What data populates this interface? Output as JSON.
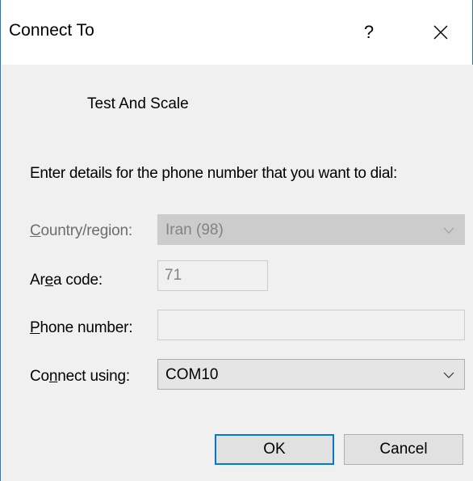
{
  "dialog": {
    "title": "Connect To",
    "help_glyph": "?",
    "close_icon": "close-icon"
  },
  "connection": {
    "name": "Test And Scale"
  },
  "instruction": "Enter details for the phone number that you want to dial:",
  "fields": {
    "country": {
      "label_pre": "",
      "label_ul": "C",
      "label_post": "ountry/region:",
      "value": "Iran (98)",
      "disabled": true
    },
    "area": {
      "label_pre": "Ar",
      "label_ul": "e",
      "label_post": "a code:",
      "value": "71",
      "disabled": true
    },
    "phone": {
      "label_pre": "",
      "label_ul": "P",
      "label_post": "hone number:",
      "value": "",
      "disabled": true
    },
    "connect_using": {
      "label_pre": "Co",
      "label_ul": "n",
      "label_post": "nect using:",
      "value": "COM10",
      "disabled": false
    }
  },
  "buttons": {
    "ok": "OK",
    "cancel": "Cancel"
  },
  "colors": {
    "accent": "#0078d7",
    "window_border": "#1e78d2",
    "client_bg": "#f0f0f0",
    "disabled_text": "#838383"
  }
}
